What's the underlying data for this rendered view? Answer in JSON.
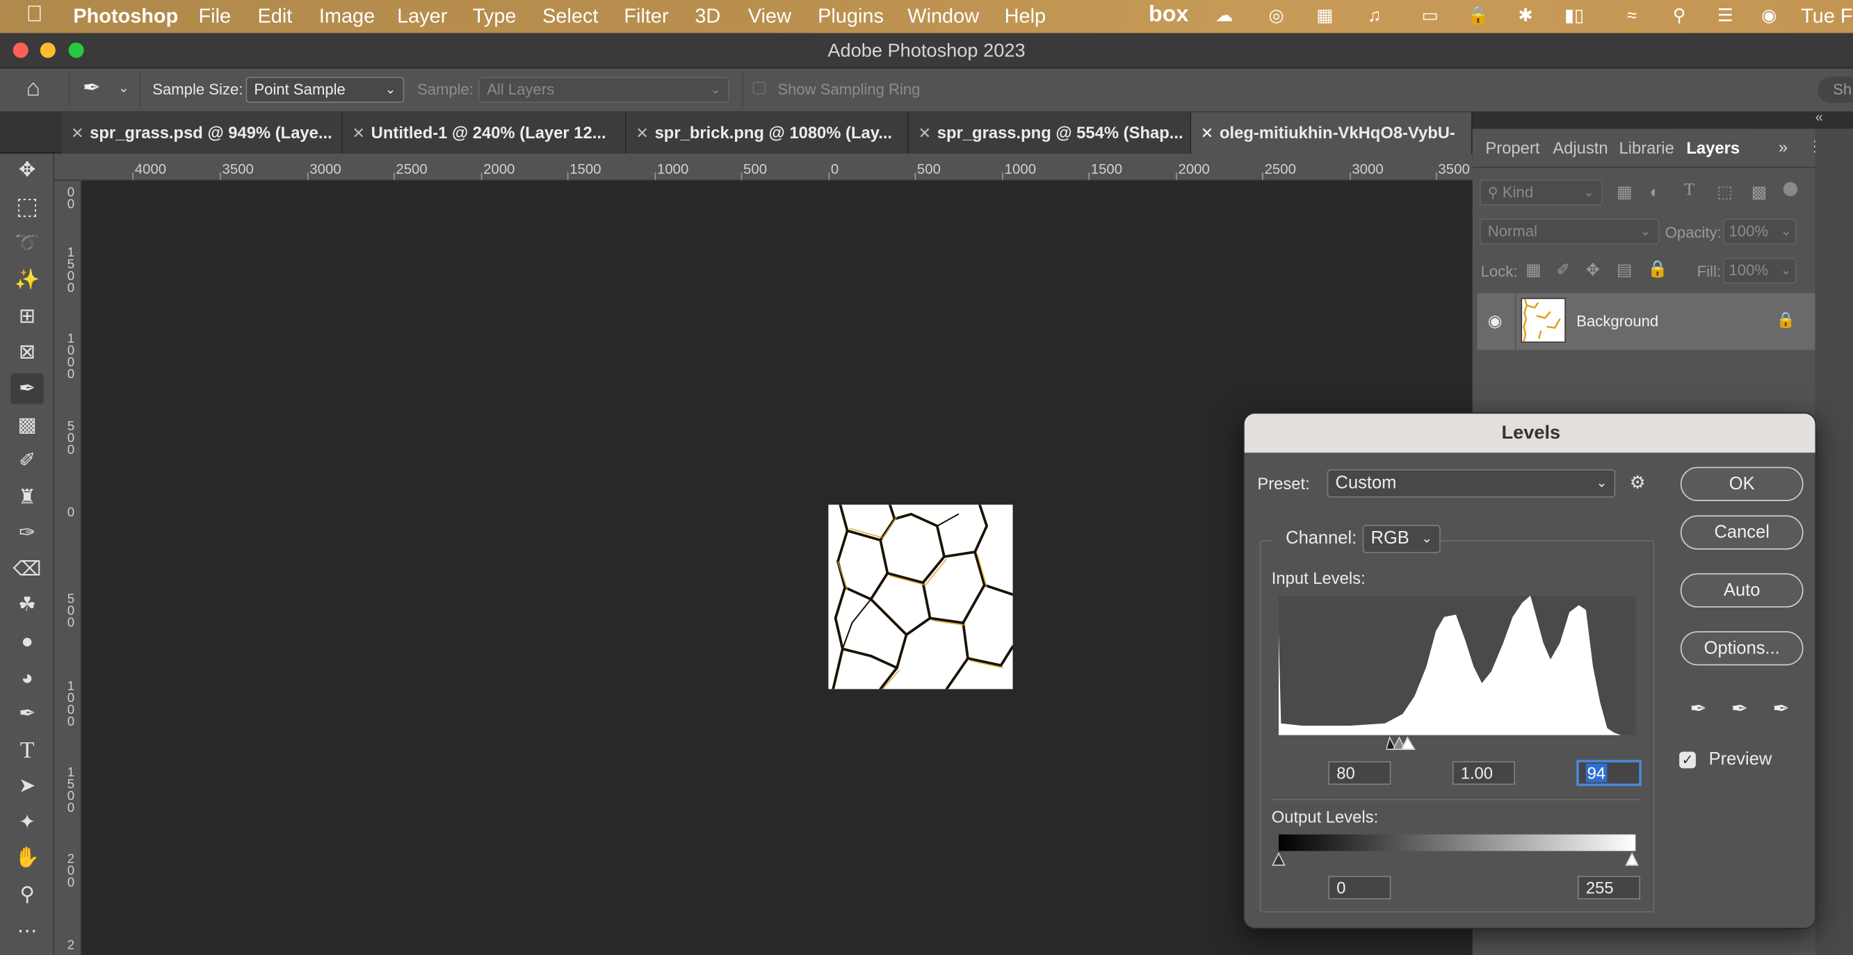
{
  "menubar": {
    "app_name": "Photoshop",
    "items": [
      "File",
      "Edit",
      "Image",
      "Layer",
      "Type",
      "Select",
      "Filter",
      "3D",
      "View",
      "Plugins",
      "Window",
      "Help"
    ],
    "status": {
      "box_label": "box",
      "clock": "Tue Fe"
    }
  },
  "window": {
    "title": "Adobe Photoshop 2023"
  },
  "options_bar": {
    "sample_size_label": "Sample Size:",
    "sample_size_value": "Point Sample",
    "sample_label": "Sample:",
    "sample_value": "All Layers",
    "show_sampling_ring": "Show Sampling Ring",
    "right_cut": "Sh"
  },
  "doc_tabs": [
    {
      "label": "spr_grass.psd @ 949% (Laye..."
    },
    {
      "label": "Untitled-1 @ 240% (Layer 12..."
    },
    {
      "label": "spr_brick.png @ 1080% (Lay..."
    },
    {
      "label": "spr_grass.png @ 554% (Shap..."
    },
    {
      "label": "oleg-mitiukhin-VkHqO8-VybU-"
    }
  ],
  "rulers": {
    "horizontal": [
      "4000",
      "3500",
      "3000",
      "2500",
      "2000",
      "1500",
      "1000",
      "500",
      "0",
      "500",
      "1000",
      "1500",
      "2000",
      "2500",
      "3000",
      "3500"
    ],
    "vertical": [
      "00",
      "1500",
      "1000",
      "500",
      "0",
      "500",
      "1000",
      "1500",
      "200",
      "2"
    ]
  },
  "layers_panel": {
    "tabs": [
      "Propert",
      "Adjustn",
      "Librarie",
      "Layers"
    ],
    "active_tab": "Layers",
    "filter_kind": "Kind",
    "blend_mode": "Normal",
    "opacity_label": "Opacity:",
    "opacity_value": "100%",
    "lock_label": "Lock:",
    "fill_label": "Fill:",
    "fill_value": "100%",
    "layers": [
      {
        "name": "Background",
        "visible": true,
        "locked": true
      }
    ]
  },
  "levels_dialog": {
    "title": "Levels",
    "preset_label": "Preset:",
    "preset_value": "Custom",
    "channel_label": "Channel:",
    "channel_value": "RGB",
    "input_levels_label": "Input Levels:",
    "input_black": "80",
    "input_gamma": "1.00",
    "input_white": "94",
    "output_levels_label": "Output Levels:",
    "output_black": "0",
    "output_white": "255",
    "buttons": {
      "ok": "OK",
      "cancel": "Cancel",
      "auto": "Auto",
      "options": "Options..."
    },
    "preview_label": "Preview",
    "preview_checked": true,
    "colors": {
      "selection": "#2f6fd1",
      "title_bg": "#e2dfdd"
    }
  }
}
